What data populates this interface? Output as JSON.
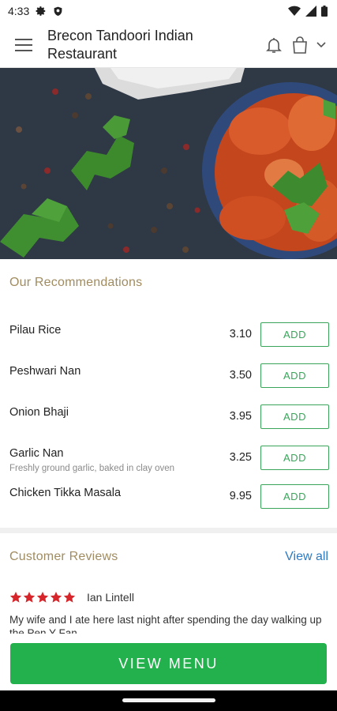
{
  "status": {
    "time": "4:33"
  },
  "header": {
    "title_line1": "Brecon Tandoori Indian",
    "title_line2": "Restaurant"
  },
  "recommendations": {
    "heading": "Our Recommendations",
    "items": [
      {
        "name": "Pilau Rice",
        "description": "",
        "price": "3.10",
        "button": "ADD"
      },
      {
        "name": "Peshwari Nan",
        "description": "",
        "price": "3.50",
        "button": "ADD"
      },
      {
        "name": "Onion Bhaji",
        "description": "",
        "price": "3.95",
        "button": "ADD"
      },
      {
        "name": "Garlic Nan",
        "description": "Freshly ground garlic, baked in clay oven",
        "price": "3.25",
        "button": "ADD"
      },
      {
        "name": "Chicken Tikka Masala",
        "description": "",
        "price": "9.95",
        "button": "ADD"
      }
    ]
  },
  "reviews": {
    "heading": "Customer Reviews",
    "view_all": "View all",
    "first": {
      "rating": 5,
      "author": "Ian Lintell",
      "text": "My wife and I ate here last night after spending the day walking up the Pen Y Fan"
    }
  },
  "cta": {
    "label": "VIEW MENU"
  },
  "colors": {
    "accent_green": "#23b14d",
    "add_border": "#3aa55a",
    "heading_gold": "#a08c60",
    "link_blue": "#2f7ac0",
    "star_red": "#d6262b"
  },
  "icons": [
    "settings-icon",
    "shield-icon",
    "wifi-icon",
    "signal-icon",
    "battery-icon",
    "menu-icon",
    "bell-icon",
    "bag-icon",
    "chevron-down-icon",
    "star-icon"
  ]
}
